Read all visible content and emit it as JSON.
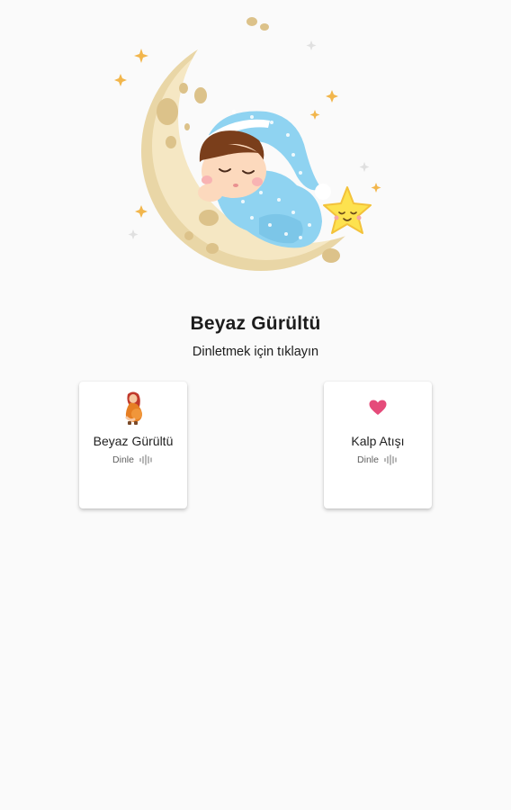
{
  "header": {
    "title": "Beyaz Gürültü",
    "subtitle": "Dinletmek için tıklayın"
  },
  "cards": [
    {
      "title": "Beyaz Gürültü",
      "action_label": "Dinle",
      "icon": "pregnant-woman-icon"
    },
    {
      "title": "Kalp Atışı",
      "action_label": "Dinle",
      "icon": "heart-icon"
    }
  ],
  "colors": {
    "background": "#fafafa",
    "card": "#ffffff",
    "heart": "#e54b7a",
    "moon": "#f3e3bd",
    "pajama": "#8fd3f1",
    "star": "#fde24f"
  }
}
